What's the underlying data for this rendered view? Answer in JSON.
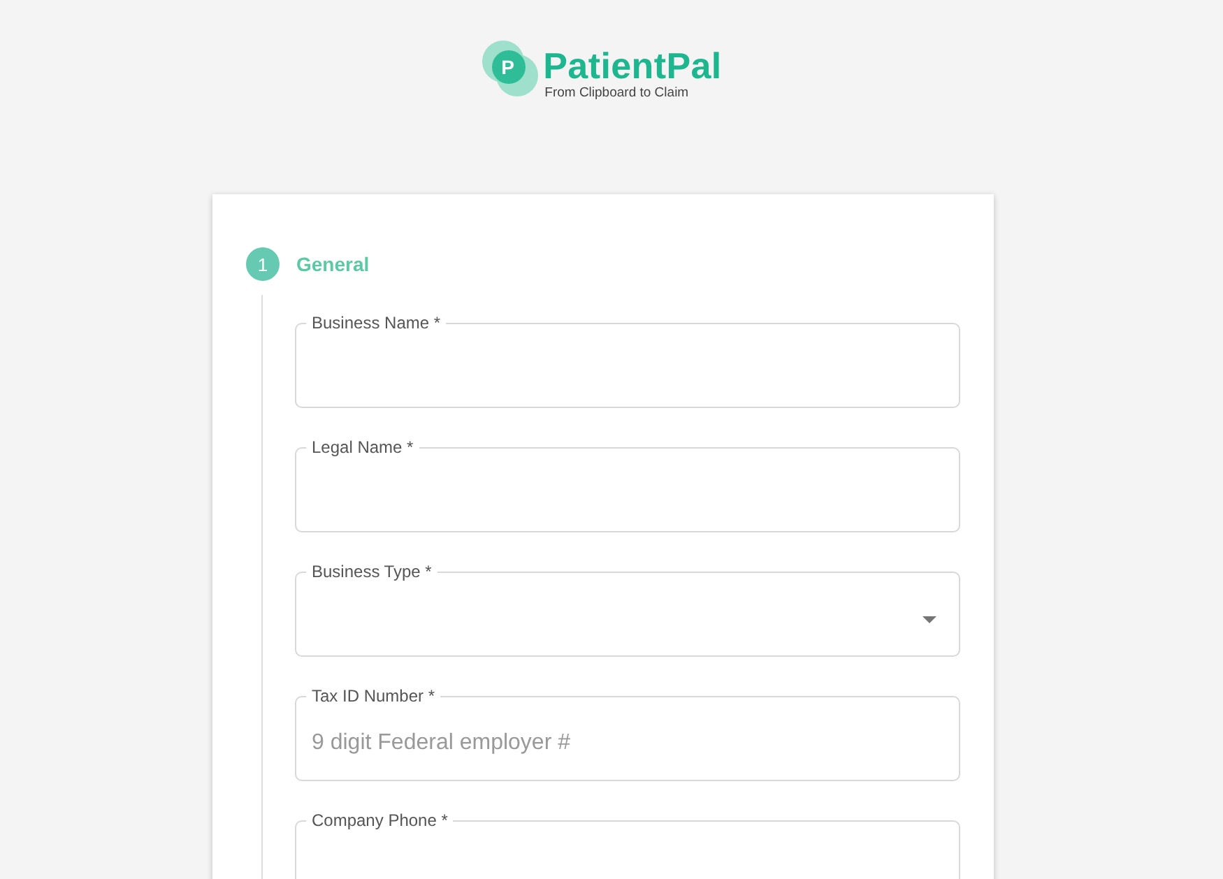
{
  "logo": {
    "mark": "P",
    "name": "PatientPal",
    "tagline": "From Clipboard to Claim"
  },
  "steps": [
    {
      "number": "1",
      "title": "General",
      "active": true,
      "fields": [
        {
          "kind": "text",
          "label": "Business Name *"
        },
        {
          "kind": "text",
          "label": "Legal Name *"
        },
        {
          "kind": "select",
          "label": "Business Type *"
        },
        {
          "kind": "text",
          "label": "Tax ID Number *",
          "placeholder": "9 digit Federal employer #"
        },
        {
          "kind": "text",
          "label": "Company Phone *"
        }
      ]
    }
  ]
}
